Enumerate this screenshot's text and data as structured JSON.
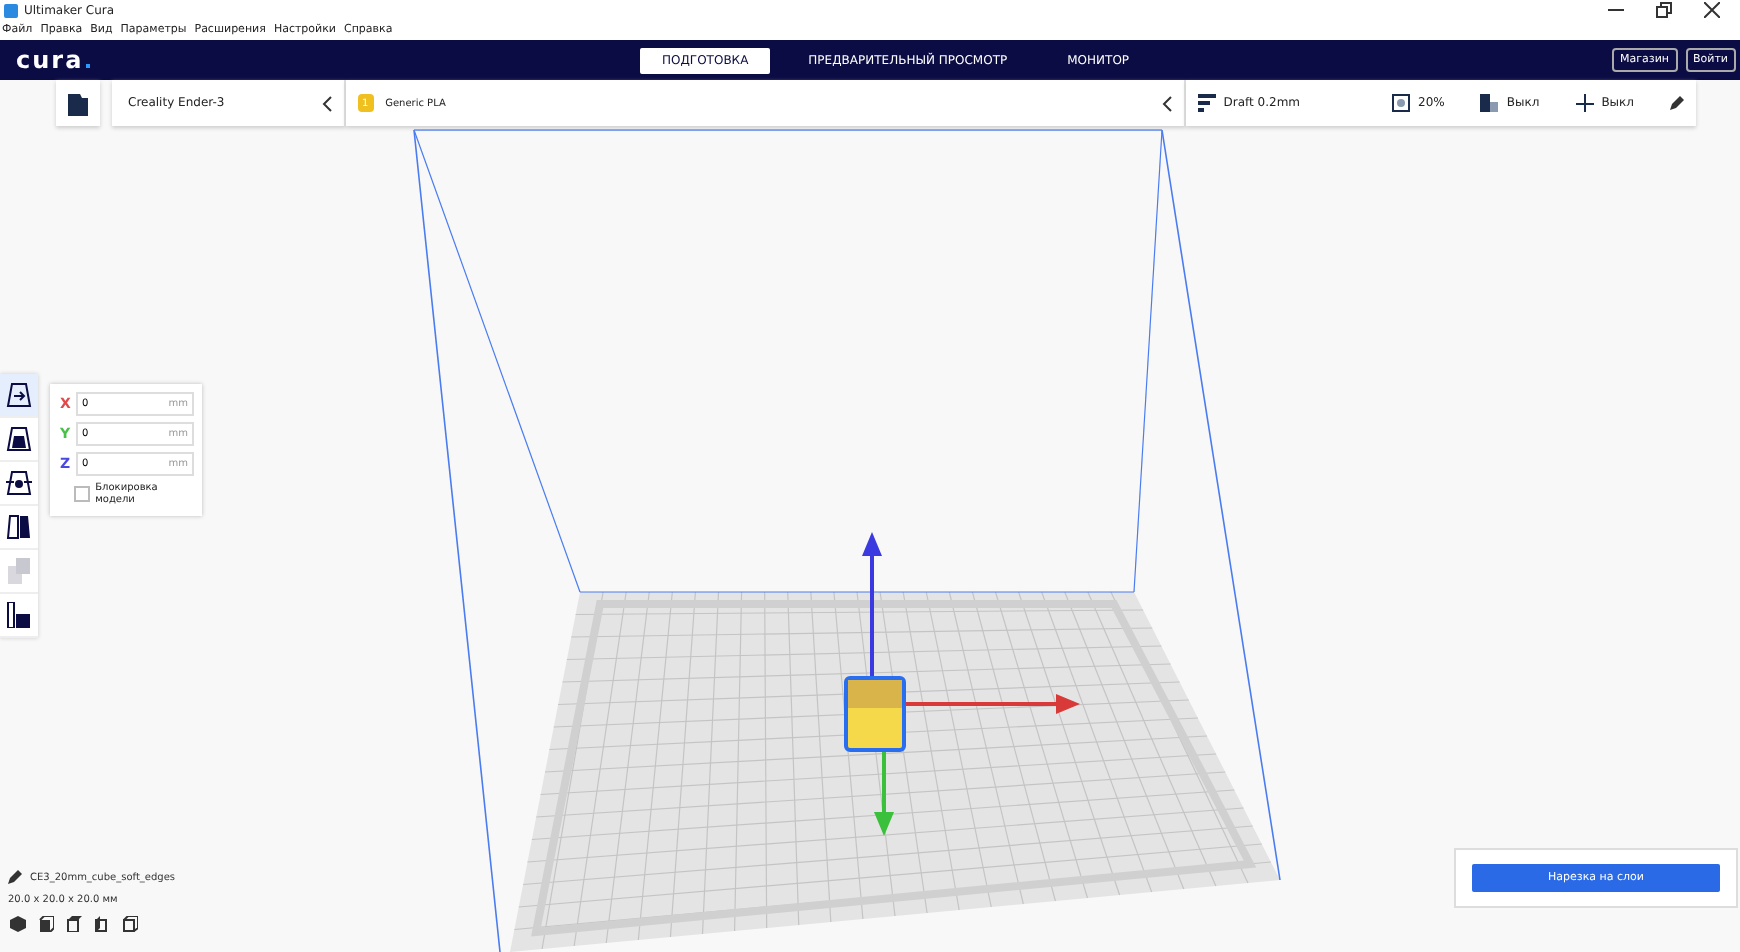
{
  "window": {
    "title": "Ultimaker Cura"
  },
  "menu": [
    "Файл",
    "Правка",
    "Вид",
    "Параметры",
    "Расширения",
    "Настройки",
    "Справка"
  ],
  "header": {
    "logo": "cura",
    "tabs": [
      {
        "label": "ПОДГОТОВКА",
        "selected": true
      },
      {
        "label": "ПРЕДВАРИТЕЛЬНЫЙ ПРОСМОТР",
        "selected": false
      },
      {
        "label": "МОНИТОР",
        "selected": false
      }
    ],
    "buttons": [
      "Магазин",
      "Войти"
    ]
  },
  "printer": {
    "name": "Creality Ender-3"
  },
  "material": {
    "badge": "1",
    "name": "Generic PLA"
  },
  "print_settings": {
    "profile": "Draft 0.2mm",
    "infill": "20%",
    "support": "Выкл",
    "adhesion": "Выкл"
  },
  "tools": [
    {
      "kind": "move",
      "selected": true,
      "disabled": false
    },
    {
      "kind": "scale",
      "selected": false,
      "disabled": false
    },
    {
      "kind": "rotate",
      "selected": false,
      "disabled": false
    },
    {
      "kind": "mirror",
      "selected": false,
      "disabled": false
    },
    {
      "kind": "multiply",
      "selected": false,
      "disabled": true
    },
    {
      "kind": "support",
      "selected": false,
      "disabled": false
    }
  ],
  "move_panel": {
    "fields": [
      {
        "axis": "X",
        "color": "#e04a4a",
        "value": "0",
        "unit": "mm"
      },
      {
        "axis": "Y",
        "color": "#4ac04a",
        "value": "0",
        "unit": "mm"
      },
      {
        "axis": "Z",
        "color": "#4a4ae0",
        "value": "0",
        "unit": "mm"
      }
    ],
    "lock": {
      "label": "Блокировка модели",
      "checked": false
    }
  },
  "object": {
    "name": "CE3_20mm_cube_soft_edges",
    "dimensions": "20.0 x 20.0 x 20.0 мм"
  },
  "view_buttons": [
    {
      "kind": "perspective"
    },
    {
      "kind": "front"
    },
    {
      "kind": "top"
    },
    {
      "kind": "left"
    },
    {
      "kind": "right"
    }
  ],
  "slice_button": "Нарезка на слои"
}
